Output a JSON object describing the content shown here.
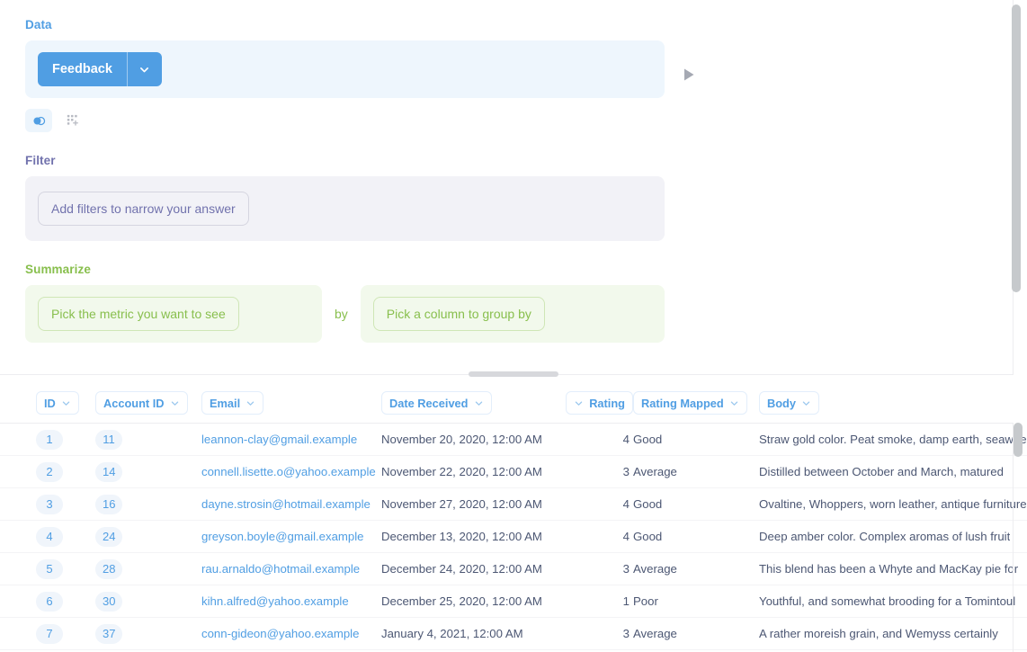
{
  "notebook": {
    "data": {
      "title": "Data",
      "source_label": "Feedback",
      "caret_icon": "chevron-down-icon",
      "run_icon": "play-icon",
      "actions": [
        {
          "icon": "join-data-icon",
          "active": true
        },
        {
          "icon": "pick-columns-icon",
          "active": false
        }
      ]
    },
    "filter": {
      "title": "Filter",
      "placeholder": "Add filters to narrow your answer"
    },
    "summarize": {
      "title": "Summarize",
      "metric_placeholder": "Pick the metric you want to see",
      "by_label": "by",
      "group_placeholder": "Pick a column to group by"
    }
  },
  "table": {
    "columns": [
      {
        "label": "ID",
        "key": "id",
        "align": "left",
        "chevron": "right",
        "type": "pill"
      },
      {
        "label": "Account ID",
        "key": "account_id",
        "align": "left",
        "chevron": "right",
        "type": "pill"
      },
      {
        "label": "Email",
        "key": "email",
        "align": "left",
        "chevron": "right",
        "type": "link"
      },
      {
        "label": "Date Received",
        "key": "date_received",
        "align": "left",
        "chevron": "right",
        "type": "text"
      },
      {
        "label": "Rating",
        "key": "rating",
        "align": "right",
        "chevron": "left",
        "type": "number"
      },
      {
        "label": "Rating Mapped",
        "key": "rating_mapped",
        "align": "left",
        "chevron": "right",
        "type": "text"
      },
      {
        "label": "Body",
        "key": "body",
        "align": "left",
        "chevron": "right",
        "type": "text"
      }
    ],
    "rows": [
      {
        "id": "1",
        "account_id": "11",
        "email": "leannon-clay@gmail.example",
        "date_received": "November 20, 2020, 12:00 AM",
        "rating": "4",
        "rating_mapped": "Good",
        "body": "Straw gold color. Peat smoke, damp earth, seaweed"
      },
      {
        "id": "2",
        "account_id": "14",
        "email": "connell.lisette.o@yahoo.example",
        "date_received": "November 22, 2020, 12:00 AM",
        "rating": "3",
        "rating_mapped": "Average",
        "body": "Distilled between October and March, matured"
      },
      {
        "id": "3",
        "account_id": "16",
        "email": "dayne.strosin@hotmail.example",
        "date_received": "November 27, 2020, 12:00 AM",
        "rating": "4",
        "rating_mapped": "Good",
        "body": "Ovaltine, Whoppers, worn leather, antique furniture"
      },
      {
        "id": "4",
        "account_id": "24",
        "email": "greyson.boyle@gmail.example",
        "date_received": "December 13, 2020, 12:00 AM",
        "rating": "4",
        "rating_mapped": "Good",
        "body": "Deep amber color. Complex aromas of lush fruit"
      },
      {
        "id": "5",
        "account_id": "28",
        "email": "rau.arnaldo@hotmail.example",
        "date_received": "December 24, 2020, 12:00 AM",
        "rating": "3",
        "rating_mapped": "Average",
        "body": "This blend has been a Whyte and MacKay pie for"
      },
      {
        "id": "6",
        "account_id": "30",
        "email": "kihn.alfred@yahoo.example",
        "date_received": "December 25, 2020, 12:00 AM",
        "rating": "1",
        "rating_mapped": "Poor",
        "body": "Youthful, and somewhat brooding for a Tomintoul"
      },
      {
        "id": "7",
        "account_id": "37",
        "email": "conn-gideon@yahoo.example",
        "date_received": "January 4, 2021, 12:00 AM",
        "rating": "3",
        "rating_mapped": "Average",
        "body": "A rather moreish grain, and Wemyss certainly"
      }
    ]
  },
  "colors": {
    "data_accent": "#509ee3",
    "filter_accent": "#7172ad",
    "summarize_accent": "#88bf4d",
    "text": "#4c5773"
  }
}
